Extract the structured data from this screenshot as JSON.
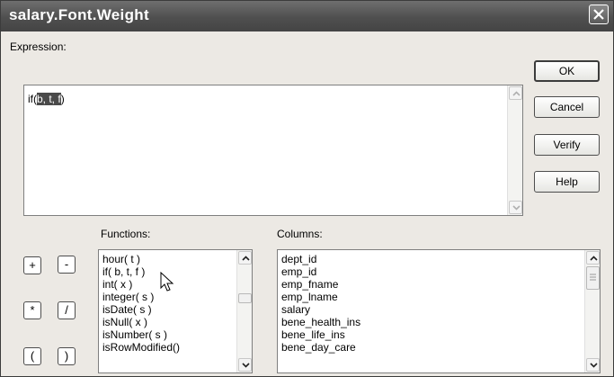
{
  "window": {
    "title": "salary.Font.Weight"
  },
  "expression": {
    "label": "Expression:",
    "prefix": "if(",
    "selected": "b, t, f",
    "suffix": ")"
  },
  "buttons": {
    "ok": "OK",
    "cancel": "Cancel",
    "verify": "Verify",
    "help": "Help"
  },
  "operators": [
    "+",
    "-",
    "*",
    "/",
    "(",
    ")"
  ],
  "functions": {
    "label": "Functions:",
    "items": [
      "hour( t )",
      "if( b, t, f )",
      "int( x )",
      "integer( s )",
      "isDate( s )",
      "isNull( x )",
      "isNumber( s )",
      "isRowModified()"
    ]
  },
  "columns": {
    "label": "Columns:",
    "items": [
      "dept_id",
      "emp_id",
      "emp_fname",
      "emp_lname",
      "salary",
      "bene_health_ins",
      "bene_life_ins",
      "bene_day_care"
    ]
  },
  "icons": {
    "close": "close-icon",
    "scroll_up": "chevron-up-icon",
    "scroll_down": "chevron-down-icon",
    "cursor": "mouse-pointer-icon"
  }
}
